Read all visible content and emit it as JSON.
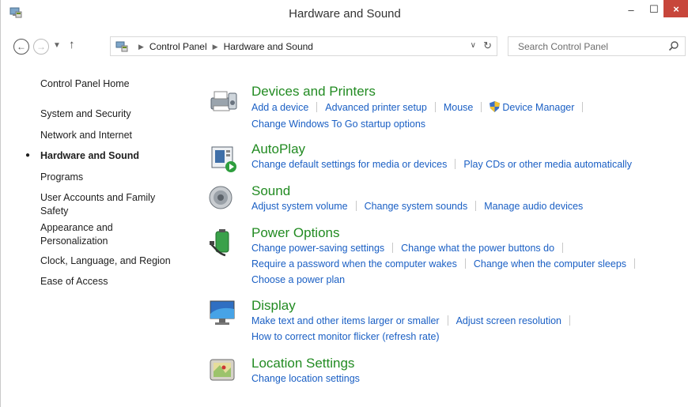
{
  "window": {
    "title": "Hardware and Sound",
    "close_glyph": "×",
    "min_glyph": "–",
    "max_glyph": "☐"
  },
  "address": {
    "breadcrumbs": [
      "Control Panel",
      "Hardware and Sound"
    ],
    "search_placeholder": "Search Control Panel"
  },
  "sidebar": {
    "home": "Control Panel Home",
    "items": [
      {
        "label": "System and Security"
      },
      {
        "label": "Network and Internet"
      },
      {
        "label": "Hardware and Sound",
        "active": true
      },
      {
        "label": "Programs"
      },
      {
        "label": "User Accounts and Family Safety"
      },
      {
        "label": "Appearance and Personalization"
      },
      {
        "label": "Clock, Language, and Region"
      },
      {
        "label": "Ease of Access"
      }
    ]
  },
  "categories": [
    {
      "title": "Devices and Printers",
      "icon": "printer-icon",
      "links": [
        [
          "Add a device",
          "Advanced printer setup",
          "Mouse",
          "Device Manager"
        ],
        [
          "Change Windows To Go startup options"
        ]
      ]
    },
    {
      "title": "AutoPlay",
      "icon": "autoplay-icon",
      "links": [
        [
          "Change default settings for media or devices",
          "Play CDs or other media automatically"
        ]
      ]
    },
    {
      "title": "Sound",
      "icon": "speaker-icon",
      "links": [
        [
          "Adjust system volume",
          "Change system sounds",
          "Manage audio devices"
        ]
      ]
    },
    {
      "title": "Power Options",
      "icon": "battery-icon",
      "links": [
        [
          "Change power-saving settings",
          "Change what the power buttons do"
        ],
        [
          "Require a password when the computer wakes",
          "Change when the computer sleeps"
        ],
        [
          "Choose a power plan"
        ]
      ]
    },
    {
      "title": "Display",
      "icon": "monitor-icon",
      "links": [
        [
          "Make text and other items larger or smaller",
          "Adjust screen resolution"
        ],
        [
          "How to correct monitor flicker (refresh rate)"
        ]
      ]
    },
    {
      "title": "Location Settings",
      "icon": "location-icon",
      "links": [
        [
          "Change location settings"
        ]
      ]
    }
  ],
  "colors": {
    "link": "#1a5fc4",
    "category_title": "#228b22",
    "close_button": "#c7463b"
  }
}
